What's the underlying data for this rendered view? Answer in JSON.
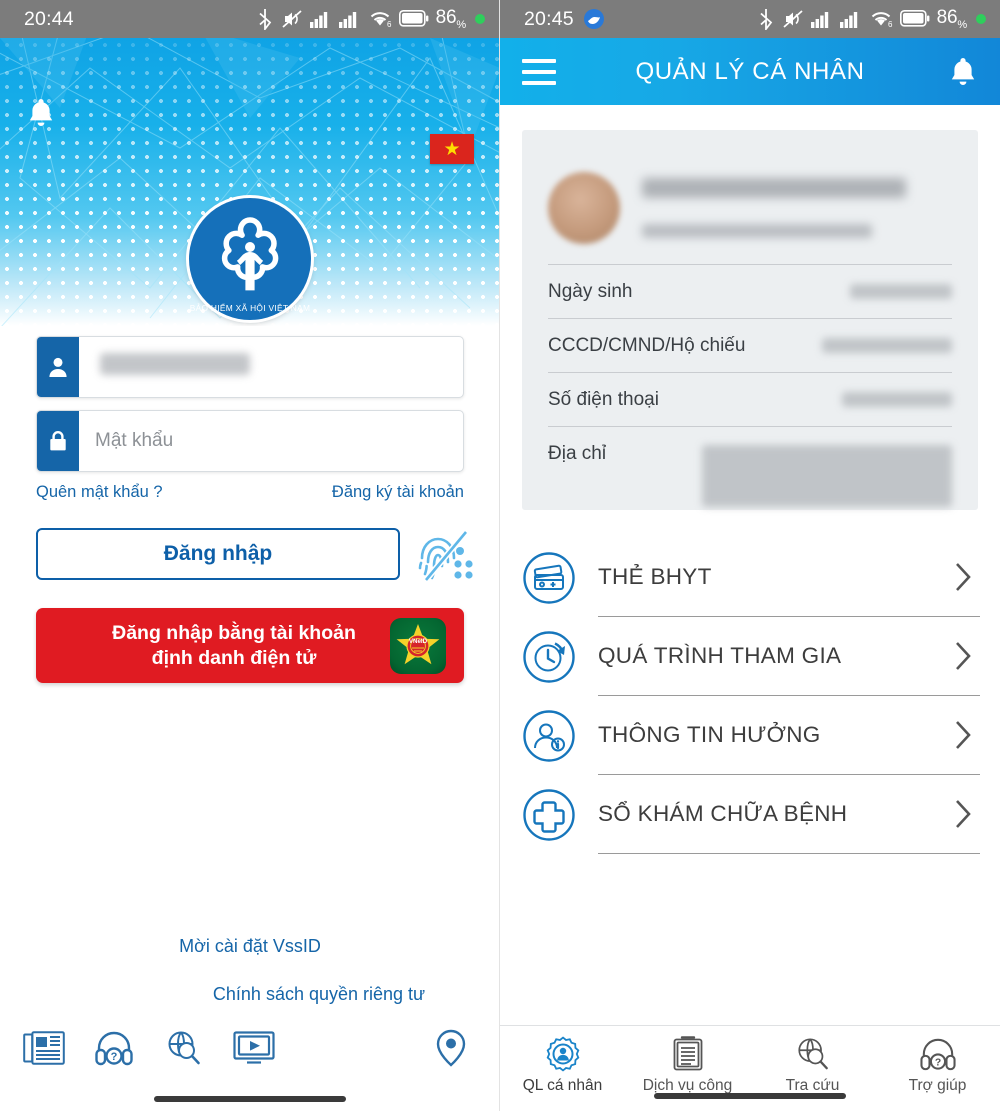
{
  "left": {
    "status": {
      "time": "20:44",
      "battery": "86",
      "battery_unit": "%",
      "icons": [
        "bluetooth-icon",
        "mute-icon",
        "signal-1-icon",
        "signal-2-icon",
        "wifi-icon",
        "battery-icon"
      ]
    },
    "hero": {
      "bell_icon": "bell-icon",
      "flag_icon": "vietnam-flag-icon",
      "flag_star": "★",
      "logo_alt": "BẢO HIỂM XÃ HỘI VIỆT NAM",
      "logo_text": "BẢO HIỂM XÃ HỘI VIỆT NAM"
    },
    "form": {
      "username_value": "",
      "username_placeholder": "",
      "username_icon": "user-icon",
      "password_value": "",
      "password_placeholder": "Mật khẩu",
      "password_icon": "lock-icon",
      "forgot_label": "Quên mật khẩu ?",
      "register_label": "Đăng ký tài khoản",
      "login_label": "Đăng nhập",
      "fingerprint_icon": "fingerprint-disabled-icon",
      "vneid_label_line1": "Đăng nhập bằng tài khoản",
      "vneid_label_line2": "định danh điện tử",
      "vneid_logo": "vneid-logo-icon"
    },
    "footer": {
      "invite_label": "Mời cài đặt VssID",
      "privacy_label": "Chính sách quyền riêng tư",
      "icons": [
        {
          "name": "news-icon"
        },
        {
          "name": "support-headset-icon"
        },
        {
          "name": "globe-search-icon"
        },
        {
          "name": "video-player-icon"
        }
      ],
      "pin_icon": "map-pin-icon"
    },
    "colors": {
      "primary": "#1565a8",
      "hero_top": "#0fa3e5",
      "vneid_red": "#e01b22"
    }
  },
  "right": {
    "status": {
      "time": "20:45",
      "battery": "86",
      "battery_unit": "%",
      "app_icon": "vssid-app-icon"
    },
    "appbar": {
      "menu_icon": "hamburger-menu-icon",
      "title": "QUẢN LÝ CÁ NHÂN",
      "bell_icon": "bell-icon"
    },
    "profile": {
      "avatar": "user-avatar",
      "name": "",
      "subtitle": "",
      "rows": [
        {
          "label": "Ngày sinh",
          "value": ""
        },
        {
          "label": "CCCD/CMND/Hộ chiếu",
          "value": ""
        },
        {
          "label": "Số điện thoại",
          "value": ""
        },
        {
          "label": "Địa chỉ",
          "value": ""
        }
      ]
    },
    "menu": [
      {
        "label": "THẺ BHYT",
        "icon": "health-card-icon",
        "chevron": "chevron-right-icon"
      },
      {
        "label": "QUÁ TRÌNH THAM GIA",
        "icon": "history-clock-icon",
        "chevron": "chevron-right-icon"
      },
      {
        "label": "THÔNG TIN HƯỞNG",
        "icon": "user-info-icon",
        "chevron": "chevron-right-icon"
      },
      {
        "label": "SỔ KHÁM CHỮA BỆNH",
        "icon": "medical-cross-icon",
        "chevron": "chevron-right-icon"
      }
    ],
    "tabs": [
      {
        "label": "QL cá nhân",
        "icon": "personal-gear-icon",
        "active": true
      },
      {
        "label": "Dịch vụ công",
        "icon": "document-icon",
        "active": false
      },
      {
        "label": "Tra cứu",
        "icon": "globe-search-icon",
        "active": false
      },
      {
        "label": "Trợ giúp",
        "icon": "support-headset-icon",
        "active": false
      }
    ],
    "colors": {
      "appbar_left": "#12b0ea",
      "appbar_right": "#1287d8",
      "accent": "#1565a8"
    }
  }
}
